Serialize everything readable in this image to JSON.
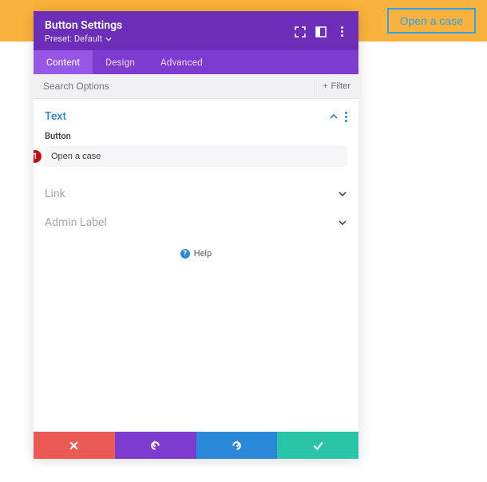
{
  "preview_button_label": "Open a case",
  "header": {
    "title": "Button Settings",
    "preset_label": "Preset: Default"
  },
  "tabs": {
    "content": "Content",
    "design": "Design",
    "advanced": "Advanced"
  },
  "search": {
    "placeholder": "Search Options",
    "filter_label": "Filter"
  },
  "sections": {
    "text": {
      "title": "Text",
      "button_label": "Button",
      "button_value": "Open a case"
    },
    "link": {
      "title": "Link"
    },
    "admin": {
      "title": "Admin Label"
    }
  },
  "help_label": "Help",
  "marker_number": "1"
}
